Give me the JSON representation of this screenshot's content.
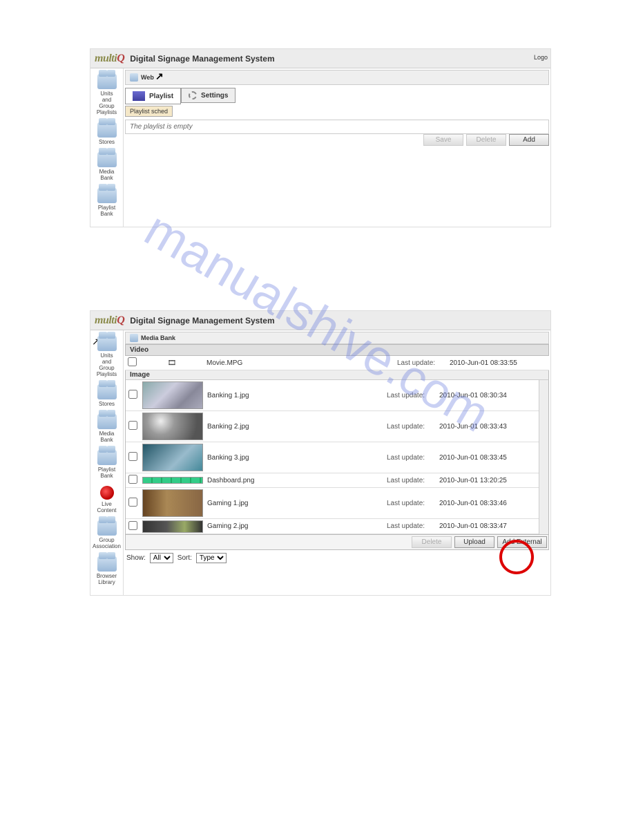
{
  "brand": {
    "name_prefix": "multi",
    "name_suffix": "Q"
  },
  "header_title": "Digital Signage Management System",
  "logo_link": "Logo",
  "shot1": {
    "crumb": "Web",
    "tabs": {
      "playlist": "Playlist",
      "settings": "Settings"
    },
    "subtab": "Playlist sched",
    "empty_msg": "The playlist is empty",
    "buttons": {
      "save": "Save",
      "delete": "Delete",
      "add": "Add"
    },
    "sidebar": [
      {
        "label": "Units\nand\nGroup\nPlaylists"
      },
      {
        "label": "Stores"
      },
      {
        "label": "Media\nBank"
      },
      {
        "label": "Playlist\nBank"
      }
    ]
  },
  "shot2": {
    "crumb": "Media Bank",
    "section_video": "Video",
    "section_image": "Image",
    "last_update_label": "Last update:",
    "rows_video": [
      {
        "name": "Movie.MPG",
        "date": "2010-Jun-01 08:33:55"
      }
    ],
    "rows_image": [
      {
        "name": "Banking 1.jpg",
        "date": "2010-Jun-01 08:30:34",
        "thumb": "t1"
      },
      {
        "name": "Banking 2.jpg",
        "date": "2010-Jun-01 08:33:43",
        "thumb": "t2"
      },
      {
        "name": "Banking 3.jpg",
        "date": "2010-Jun-01 08:33:45",
        "thumb": "t3"
      },
      {
        "name": "Dashboard.png",
        "date": "2010-Jun-01 13:20:25",
        "thumb": "dash"
      },
      {
        "name": "Gaming 1.jpg",
        "date": "2010-Jun-01 08:33:46",
        "thumb": "t5"
      },
      {
        "name": "Gaming 2.jpg",
        "date": "2010-Jun-01 08:33:47",
        "thumb": "t6"
      }
    ],
    "buttons": {
      "delete": "Delete",
      "upload": "Upload",
      "add_external": "Add External"
    },
    "filters": {
      "show_label": "Show:",
      "show_value": "All",
      "sort_label": "Sort:",
      "sort_value": "Type"
    },
    "sidebar": [
      {
        "label": "Units\nand\nGroup\nPlaylists"
      },
      {
        "label": "Stores"
      },
      {
        "label": "Media\nBank"
      },
      {
        "label": "Playlist\nBank"
      },
      {
        "label": "Live\nContent",
        "live": true
      },
      {
        "label": "Group\nAssociation"
      },
      {
        "label": "Browser\nLibrary"
      }
    ]
  },
  "watermark": "manualshive.com"
}
